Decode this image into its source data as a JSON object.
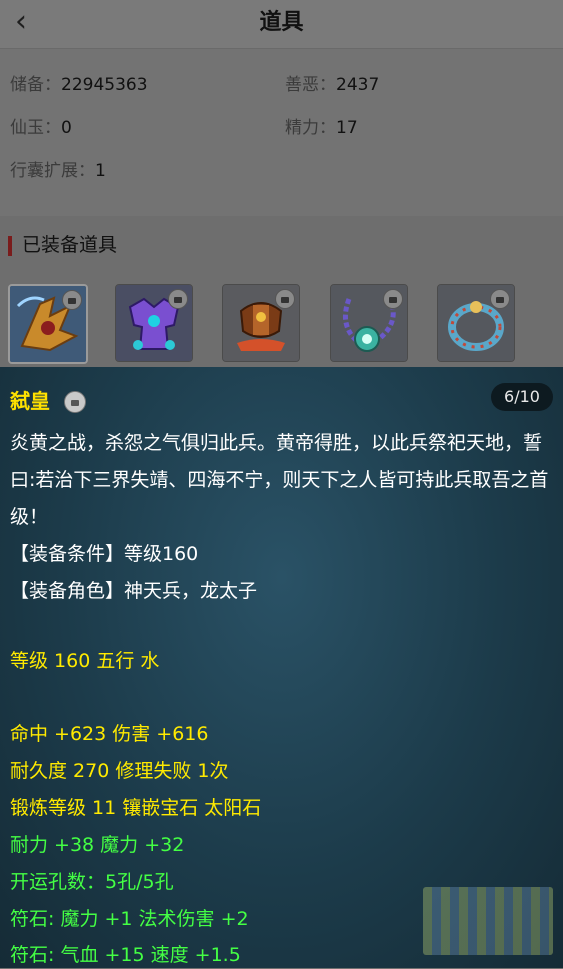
{
  "header": {
    "back_icon": "chevron-left-icon",
    "title": "道具"
  },
  "info": {
    "row1": {
      "k1": "储备：",
      "v1": "22945363",
      "k2": "善恶：",
      "v2": "2437"
    },
    "row2": {
      "k1": "仙玉：",
      "v1": "0",
      "k2": "精力：",
      "v2": "17"
    },
    "row3": {
      "k1": "行囊扩展：",
      "v1": "1"
    }
  },
  "equipped": {
    "title": "已装备道具",
    "slots": [
      {
        "icon": "weapon-icon",
        "color": "#c98a2b"
      },
      {
        "icon": "armor-icon",
        "color": "#7a4fd0"
      },
      {
        "icon": "shield-icon",
        "color": "#b5652a"
      },
      {
        "icon": "necklace-icon",
        "color": "#3bb2a1"
      },
      {
        "icon": "ring-icon",
        "color": "#5aa7c9"
      }
    ]
  },
  "detail": {
    "name": "弑皇",
    "count": "6/10",
    "desc": "炎黄之战，杀怨之气俱归此兵。黄帝得胜，以此兵祭祀天地，誓曰:若治下三界失靖、四海不宁，则天下之人皆可持此兵取吾之首级！",
    "cond": "【装备条件】等级160",
    "role": "【装备角色】神天兵，龙太子",
    "level": "等级 160 五行 水",
    "s1": "命中 +623 伤害 +616",
    "s2": "耐久度 270 修理失败 1次",
    "s3": "锻炼等级 11 镶嵌宝石 太阳石",
    "s4": "耐力 +38 魔力 +32",
    "s5": "开运孔数：5孔/5孔",
    "s6": "符石: 魔力 +1 法术伤害 +2",
    "s7": "符石: 气血 +15 速度 +1.5"
  }
}
